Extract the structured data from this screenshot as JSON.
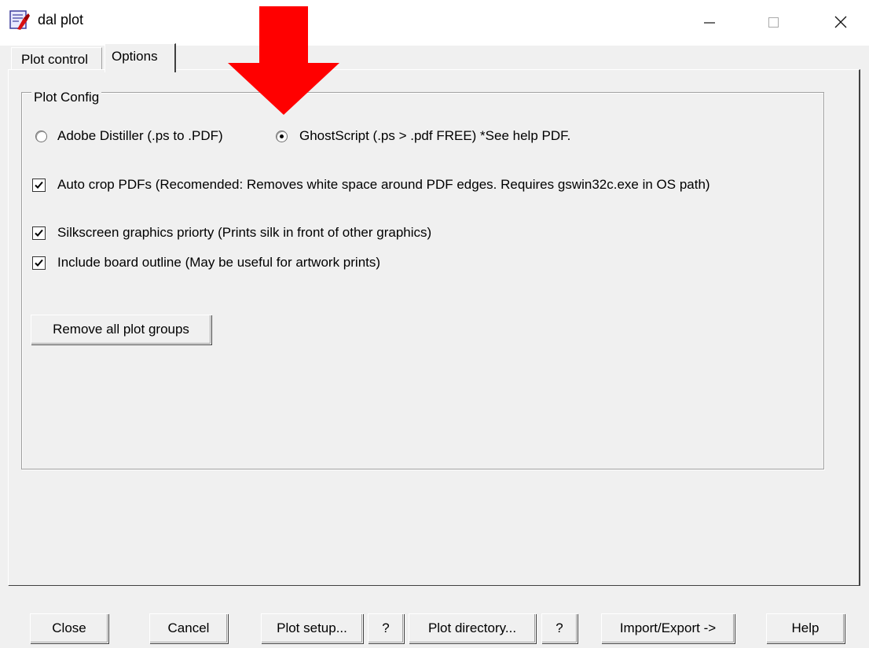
{
  "window": {
    "title": "dal plot",
    "controls": {
      "minimize": "—",
      "maximize": "☐",
      "close": "✕"
    }
  },
  "tabs": [
    {
      "label": "Plot control",
      "active": false
    },
    {
      "label": "Options",
      "active": true
    }
  ],
  "plot_config": {
    "group_label": "Plot Config",
    "radio_options": [
      {
        "label": "Adobe Distiller (.ps to .PDF)",
        "selected": false
      },
      {
        "label": "GhostScript (.ps > .pdf FREE) *See help PDF.",
        "selected": true
      }
    ],
    "checkboxes": [
      {
        "label": "Auto crop PDFs (Recomended: Removes white space around PDF edges.  Requires gswin32c.exe in OS path)",
        "checked": true
      },
      {
        "label": "Silkscreen graphics priorty (Prints silk in front of other graphics)",
        "checked": true
      },
      {
        "label": "Include board outline (May be useful for artwork prints)",
        "checked": true
      }
    ],
    "remove_button": "Remove all plot groups"
  },
  "bottom_buttons": {
    "close": "Close",
    "cancel": "Cancel",
    "plot_setup": "Plot setup...",
    "help_q1": "?",
    "plot_directory": "Plot directory...",
    "help_q2": "?",
    "import_export": "Import/Export ->",
    "help": "Help"
  },
  "colors": {
    "annotation_arrow": "#ff0000",
    "window_bg": "#f0f0f0"
  }
}
